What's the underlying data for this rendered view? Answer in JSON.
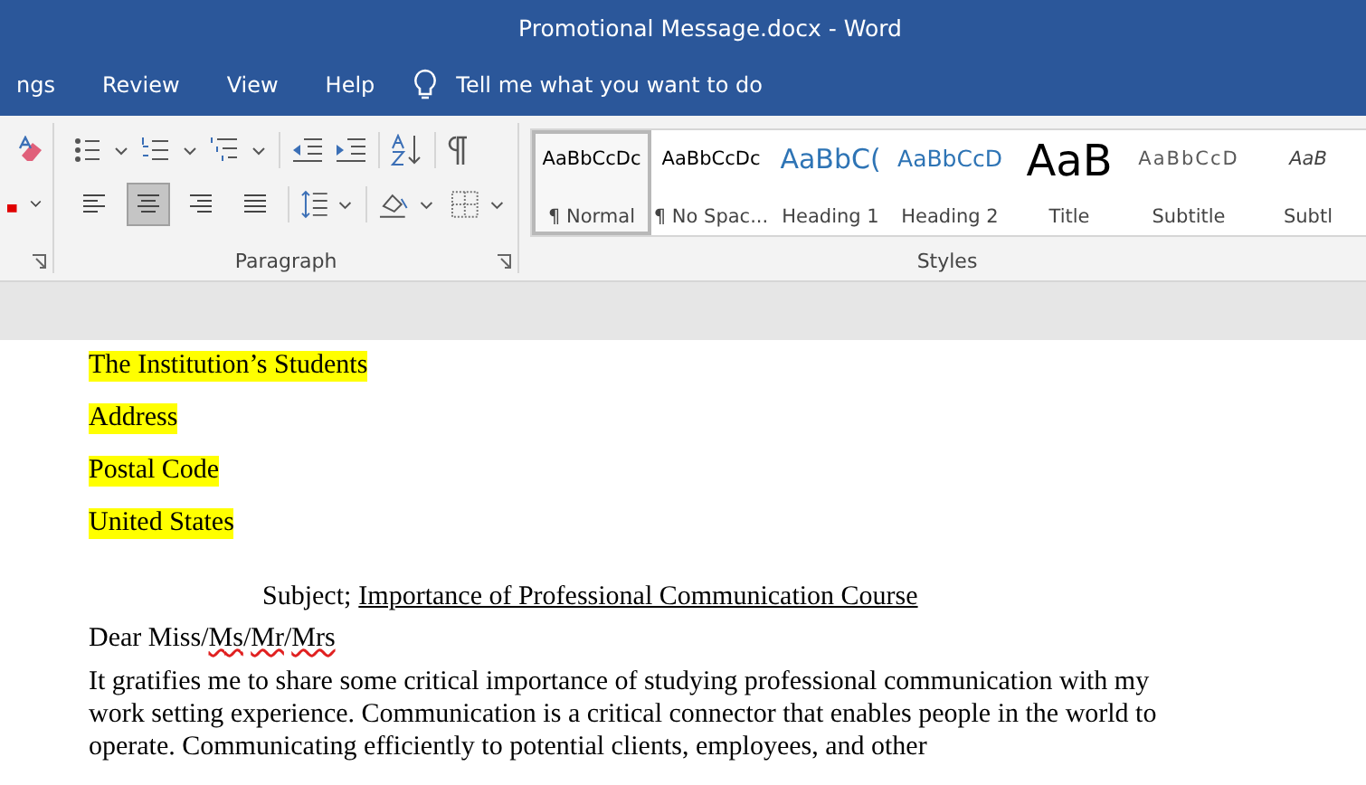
{
  "window": {
    "title": "Promotional Message.docx  -  Word"
  },
  "tabs": [
    {
      "label": "ngs",
      "selected": false
    },
    {
      "label": "Review",
      "selected": false
    },
    {
      "label": "View",
      "selected": false
    },
    {
      "label": "Help",
      "selected": false
    }
  ],
  "tell_me": {
    "placeholder": "Tell me what you want to do"
  },
  "paragraph_group": {
    "label": "Paragraph",
    "alignment": [
      {
        "selected": false
      },
      {
        "selected": true
      },
      {
        "selected": false
      },
      {
        "selected": false
      }
    ]
  },
  "styles_group": {
    "label": "Styles",
    "items": [
      {
        "kind": "normal",
        "preview": "AaBbCcDc",
        "label": "¶ Normal",
        "selected": true
      },
      {
        "kind": "no-spacing",
        "preview": "AaBbCcDc",
        "label": "¶ No Spac...",
        "selected": false
      },
      {
        "kind": "heading1",
        "preview": "AaBbC(",
        "label": "Heading 1",
        "selected": false
      },
      {
        "kind": "heading2",
        "preview": "AaBbCcD",
        "label": "Heading 2",
        "selected": false
      },
      {
        "kind": "title",
        "preview": "AaB",
        "label": "Title",
        "selected": false
      },
      {
        "kind": "subtitle",
        "preview": "AaBbCcD",
        "label": "Subtitle",
        "selected": false
      },
      {
        "kind": "subtle",
        "preview": "AaB",
        "label": "Subtl",
        "selected": false
      }
    ]
  },
  "document": {
    "address_lines": [
      {
        "text": "The Institution’s Students",
        "highlighted": true
      },
      {
        "text": "Address",
        "highlighted": true
      },
      {
        "text": "Postal Code",
        "highlighted": true
      },
      {
        "text": "United States",
        "highlighted": true
      }
    ],
    "subject": {
      "label": "Subject;",
      "text": "Importance of Professional Communication Course"
    },
    "greeting": [
      {
        "text": "Dear Miss/",
        "misspelled": false
      },
      {
        "text": "Ms",
        "misspelled": true
      },
      {
        "text": "/",
        "misspelled": false
      },
      {
        "text": "Mr",
        "misspelled": true
      },
      {
        "text": "/",
        "misspelled": false
      },
      {
        "text": "Mrs",
        "misspelled": true
      }
    ],
    "body": "It gratifies me to share some critical importance of studying professional communication with my work setting experience. Communication is a critical connector that enables people in the world to operate. Communicating efficiently to potential clients, employees, and other"
  }
}
